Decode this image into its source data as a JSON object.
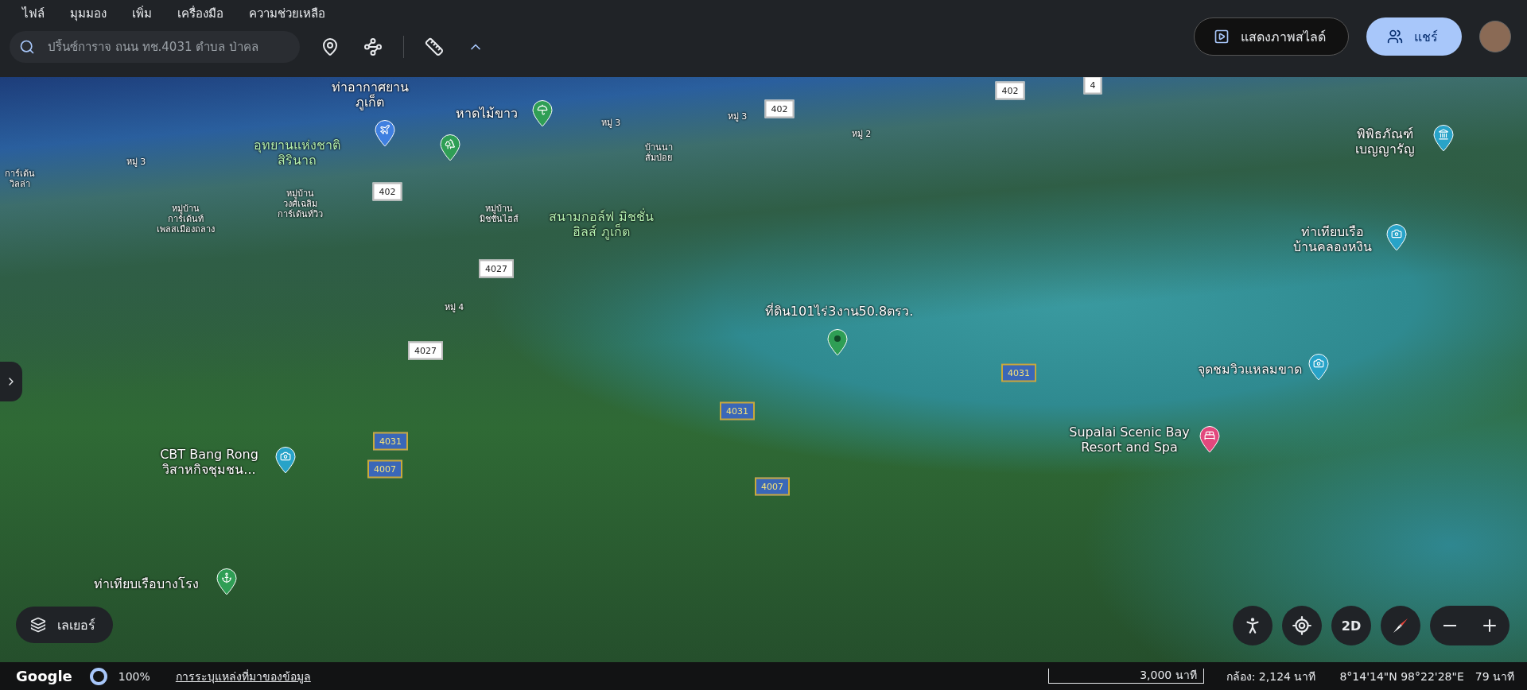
{
  "menu": [
    {
      "label": "ไฟล์"
    },
    {
      "label": "มุมมอง"
    },
    {
      "label": "เพิ่ม"
    },
    {
      "label": "เครื่องมือ"
    },
    {
      "label": "ความช่วยเหลือ"
    }
  ],
  "search": {
    "value": "ปริ้นซ์การาจ ถนน ทช.4031 ตำบล ป่าคล"
  },
  "actions": {
    "slideshow": "แสดงภาพสไลด์",
    "share": "แชร์"
  },
  "places": [
    {
      "kind": "airport",
      "lines": [
        "ท่าอากาศยาน",
        "ภูเก็ต"
      ]
    },
    {
      "kind": "beach",
      "lines": [
        "หาดไม้ขาว"
      ]
    },
    {
      "kind": "park",
      "lines": [
        "อุทยานแห่งชาติ",
        "สิรินาถ"
      ]
    },
    {
      "kind": "place",
      "lines": [
        "ที่ดิน101ไร่3งาน50.8ตรว."
      ]
    },
    {
      "kind": "museum",
      "lines": [
        "พิพิธภัณฑ์",
        "เบญญารัญ"
      ]
    },
    {
      "kind": "viewpoint",
      "lines": [
        "ท่าเทียบเรือ",
        "บ้านคลองหงิน"
      ]
    },
    {
      "kind": "viewpoint",
      "lines": [
        "จุดชมวิวแหลมขาด"
      ]
    },
    {
      "kind": "hotel",
      "lines": [
        "Supalai Scenic Bay",
        "Resort and Spa"
      ]
    },
    {
      "kind": "viewpoint",
      "lines": [
        "CBT Bang Rong",
        "วิสาหกิจชุมชน..."
      ]
    },
    {
      "kind": "pier",
      "lines": [
        "ท่าเทียบเรือบางโรง"
      ]
    }
  ],
  "areas": [
    {
      "kind": "village",
      "lines": [
        "หมู่ 3"
      ]
    },
    {
      "kind": "village",
      "lines": [
        "หมู่ 3"
      ]
    },
    {
      "kind": "village",
      "lines": [
        "หมู่ 2"
      ]
    },
    {
      "kind": "village",
      "lines": [
        "หมู่ 3"
      ]
    },
    {
      "kind": "village",
      "lines": [
        "หมู่ 4"
      ]
    },
    {
      "kind": "village",
      "lines": [
        "บ้านนา",
        "สั่มป่อย"
      ]
    },
    {
      "kind": "village",
      "lines": [
        "การ์เด้น",
        "วิลล่า"
      ]
    },
    {
      "kind": "village",
      "lines": [
        "หมู่บ้าน",
        "การ์เด้นท์",
        "เพลสเมืองถลาง"
      ]
    },
    {
      "kind": "village",
      "lines": [
        "หมู่บ้าน",
        "วงศ์เฉลิม",
        "การ์เด้นท์วิว"
      ]
    },
    {
      "kind": "village",
      "lines": [
        "หมู่บ้าน",
        "มิชชั่นไฮส์"
      ]
    },
    {
      "kind": "golf",
      "lines": [
        "สนามกอล์ฟ มิชชั่น",
        "ฮิลส์ ภูเก็ต"
      ]
    }
  ],
  "roads": [
    {
      "kind": "local",
      "number": "402"
    },
    {
      "kind": "local",
      "number": "402"
    },
    {
      "kind": "local",
      "number": "4"
    },
    {
      "kind": "local",
      "number": "402"
    },
    {
      "kind": "local",
      "number": "4027"
    },
    {
      "kind": "local",
      "number": "4027"
    },
    {
      "kind": "highway",
      "number": "4031"
    },
    {
      "kind": "highway",
      "number": "4031"
    },
    {
      "kind": "highway",
      "number": "4031"
    },
    {
      "kind": "highway",
      "number": "4007"
    },
    {
      "kind": "highway",
      "number": "4007"
    }
  ],
  "layers_button": "เลเยอร์",
  "view_controls": {
    "mode": "2D"
  },
  "status_bar": {
    "logo": "Google",
    "loading": "100%",
    "attribution": "การระบุแหล่งที่มาของข้อมูล",
    "scale": "3,000 นาที",
    "camera": "กล้อง: 2,124 นาที",
    "coordinates": "8°14'14\"N 98°22'28\"E",
    "elevation": "79 นาที"
  }
}
